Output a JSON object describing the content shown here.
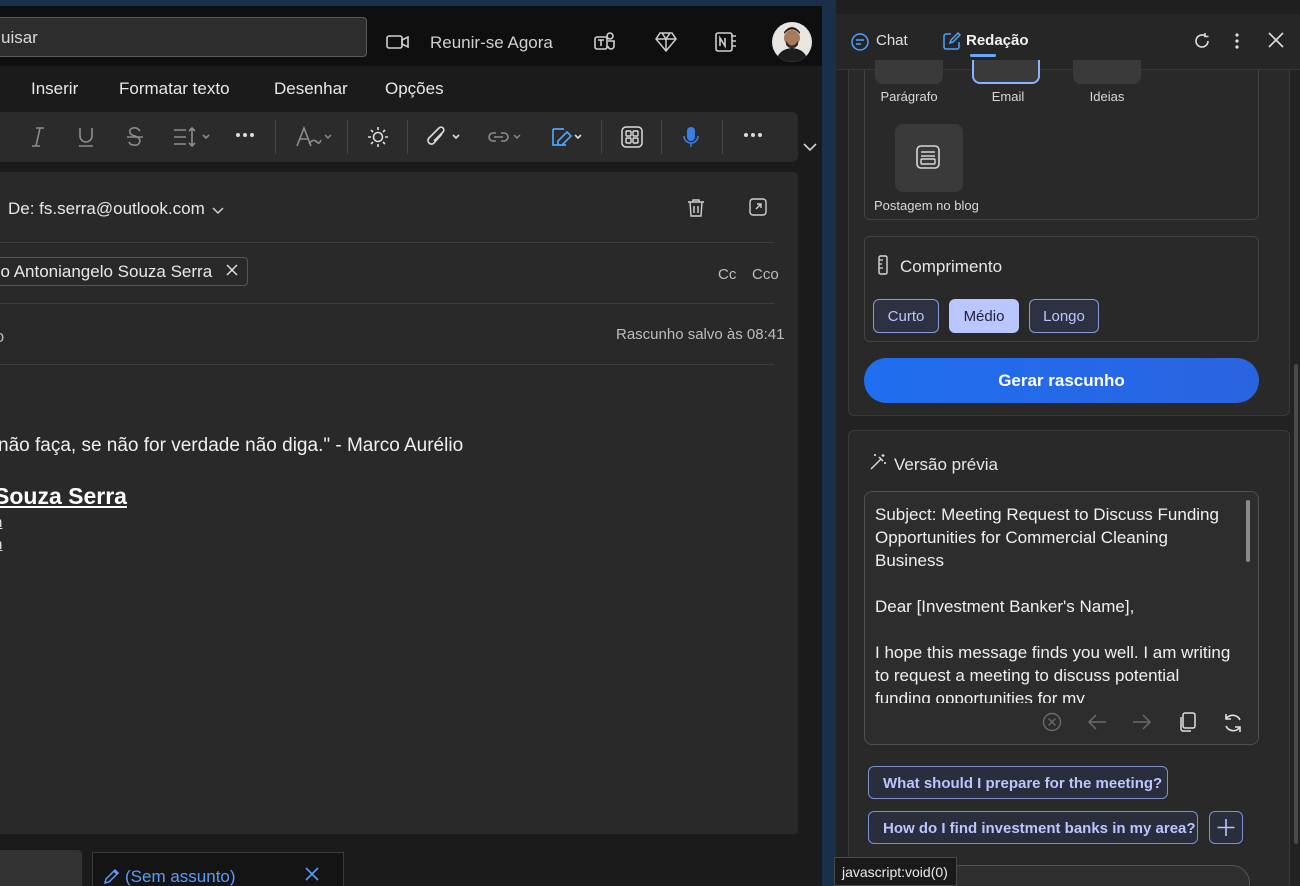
{
  "outlook": {
    "search": {
      "value": "uisar"
    },
    "meet_now": {
      "label": "Reunir-se Agora"
    },
    "menu": [
      "Inserir",
      "Formatar texto",
      "Desenhar",
      "Opções"
    ],
    "compose": {
      "from": "De: fs.serra@outlook.com",
      "recipient": "do Antoniangelo Souza Serra",
      "cc": "Cc",
      "bcc": "Cco",
      "subject_fragment": "to",
      "draft_saved": "Rascunho salvo às 08:41",
      "quote": "não faça, se não for verdade não diga.\" - Marco Aurélio",
      "signature_name": "Souza Serra",
      "signature_lines": [
        "n",
        "n"
      ]
    },
    "draft_tab": {
      "label": "(Sem assunto)"
    }
  },
  "copilot": {
    "tabs": {
      "chat": "Chat",
      "compose": "Redação"
    },
    "formats": [
      "Parágrafo",
      "Email",
      "Ideias"
    ],
    "selected_format": "Email",
    "blog_label": "Postagem no blog",
    "length": {
      "title": "Comprimento",
      "options": [
        "Curto",
        "Médio",
        "Longo"
      ],
      "selected": "Médio"
    },
    "generate_label": "Gerar rascunho",
    "preview": {
      "title": "Versão prévia",
      "text": "Subject: Meeting Request to Discuss Funding Opportunities for Commercial Cleaning Business\n\nDear [Investment Banker's Name],\n\nI hope this message finds you well. I am writing to request a meeting to discuss potential funding opportunities for my"
    },
    "suggestions": [
      "What should I prepare for the meeting?",
      "How do I find investment banks in my area?"
    ]
  },
  "status_tooltip": "javascript:void(0)",
  "colors": {
    "accent": "#2a6ef0",
    "chip_text": "#b9c6ff",
    "draft_tab_text": "#5b9bff"
  }
}
